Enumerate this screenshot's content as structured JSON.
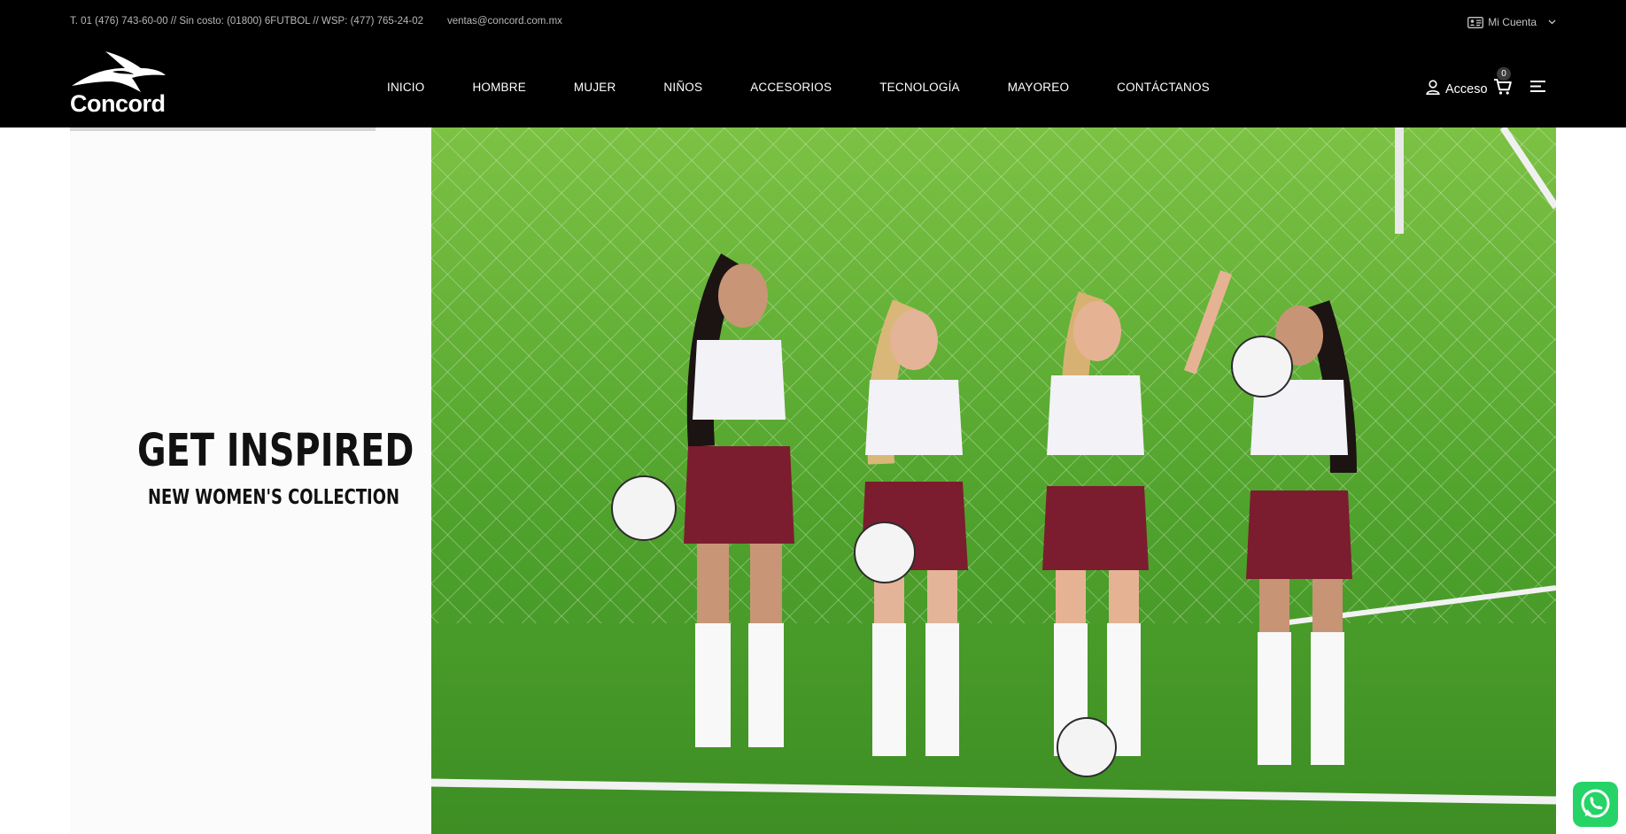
{
  "topbar": {
    "phones": "T. 01 (476) 743-60-00 // Sin costo: (01800) 6FUTBOL // WSP: (477) 765-24-02",
    "email": "ventas@concord.com.mx",
    "account_label": "Mi Cuenta"
  },
  "brand": {
    "name": "Concord"
  },
  "nav": {
    "items": [
      {
        "label": "INICIO"
      },
      {
        "label": "HOMBRE"
      },
      {
        "label": "MUJER"
      },
      {
        "label": "NIÑOS"
      },
      {
        "label": "ACCESORIOS"
      },
      {
        "label": "TECNOLOGÍA"
      },
      {
        "label": "MAYOREO"
      },
      {
        "label": "CONTÁCTANOS"
      }
    ]
  },
  "header_actions": {
    "login_label": "Acceso",
    "cart_count": "0"
  },
  "hero": {
    "title": "GET INSPIRED",
    "subtitle": "NEW WOMEN'S COLLECTION"
  },
  "colors": {
    "header_bg": "#000000",
    "whatsapp": "#25d366",
    "turf": "#5fb033"
  },
  "icons": [
    "id-card-icon",
    "chevron-down-icon",
    "user-icon",
    "cart-icon",
    "menu-icon",
    "whatsapp-icon"
  ]
}
